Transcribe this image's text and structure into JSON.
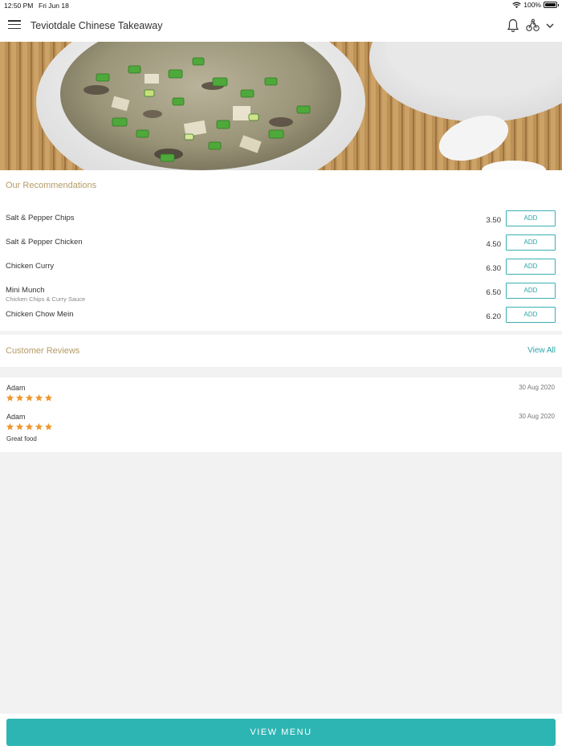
{
  "status_bar": {
    "time": "12:50 PM",
    "date": "Fri Jun 18",
    "battery": "100%"
  },
  "header": {
    "title": "Teviotdale Chinese Takeaway",
    "icons": [
      "hamburger-menu-icon",
      "bell-icon",
      "delivery-scooter-icon",
      "chevron-down-icon"
    ]
  },
  "hero": {
    "description_icon": "hot-and-sour-soup-photo"
  },
  "recommendations": {
    "title": "Our Recommendations",
    "add_label": "ADD",
    "items": [
      {
        "name": "Salt & Pepper Chips",
        "subtitle": "",
        "price": "3.50"
      },
      {
        "name": "Salt & Pepper Chicken",
        "subtitle": "",
        "price": "4.50"
      },
      {
        "name": "Chicken Curry",
        "subtitle": "",
        "price": "6.30"
      },
      {
        "name": "Mini Munch",
        "subtitle": "Chicken Chips & Curry Sauce",
        "price": "6.50"
      },
      {
        "name": "Chicken Chow Mein",
        "subtitle": "",
        "price": "6.20"
      }
    ]
  },
  "reviews": {
    "title": "Customer Reviews",
    "view_all": "View All",
    "items": [
      {
        "author": "Adam",
        "date": "30 Aug 2020",
        "rating": 5,
        "text": ""
      },
      {
        "author": "Adam",
        "date": "30 Aug 2020",
        "rating": 5,
        "text": "Great food"
      }
    ]
  },
  "footer": {
    "view_menu": "VIEW MENU"
  },
  "colors": {
    "accent": "#2db5b3",
    "section_title": "#b59a66",
    "star": "#f0962e"
  }
}
